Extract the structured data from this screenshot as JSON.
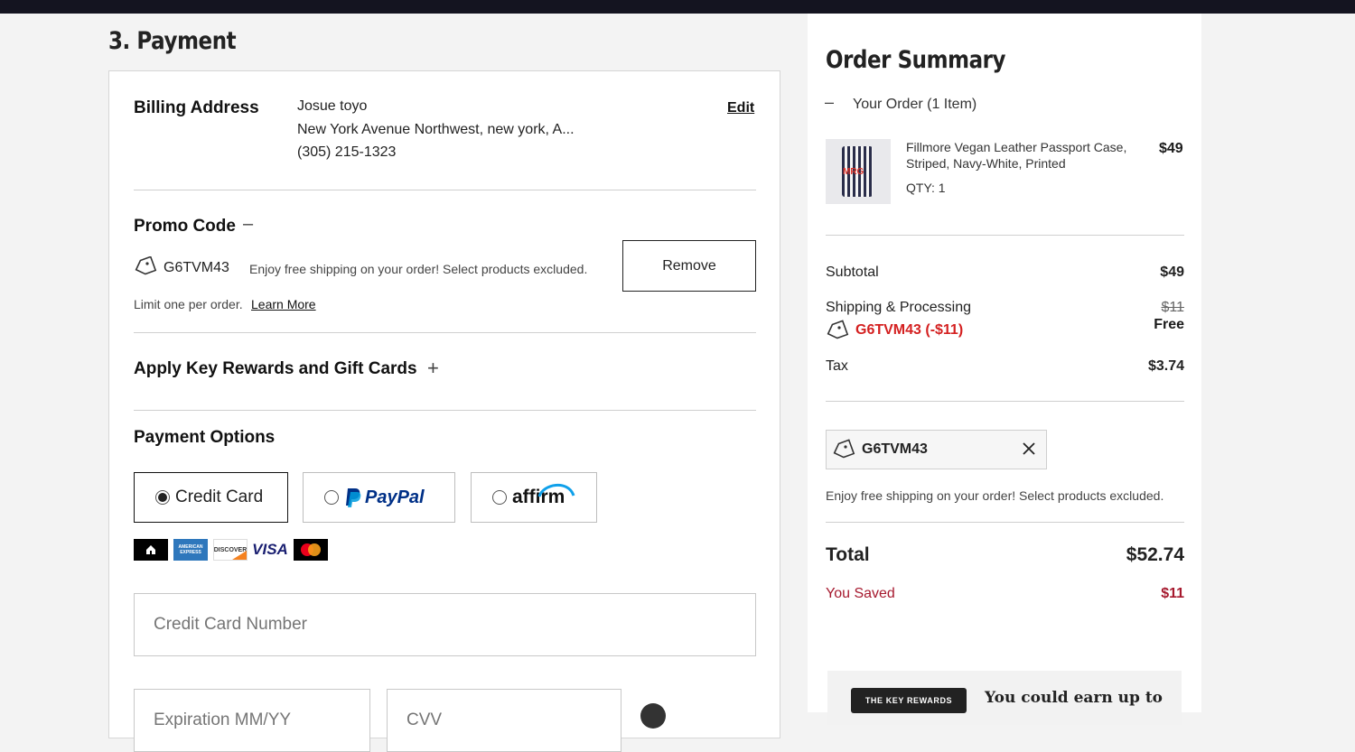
{
  "page": {
    "section_title": "3. Payment"
  },
  "billing": {
    "label": "Billing Address",
    "name": "Josue toyo",
    "address": "New York Avenue Northwest, new york, A...",
    "phone": "(305) 215-1323",
    "edit_label": "Edit"
  },
  "promo": {
    "label": "Promo Code",
    "toggle": "–",
    "code": "G6TVM43",
    "description": "Enjoy free shipping on your order! Select products excluded.",
    "remove_label": "Remove",
    "limit_text": "Limit one per order.",
    "learn_more": "Learn More"
  },
  "rewards_section": {
    "label": "Apply Key Rewards and Gift Cards",
    "toggle": "+"
  },
  "payment_options": {
    "label": "Payment Options",
    "options": [
      {
        "label": "Credit Card",
        "selected": true
      },
      {
        "label": "PayPal",
        "selected": false
      },
      {
        "label": "affirm",
        "selected": false
      }
    ],
    "card_logos": [
      "house-card-icon",
      "amex-icon",
      "discover-icon",
      "visa-icon",
      "mastercard-icon"
    ],
    "card_logo_text": {
      "amex": "AMERICAN EXPRESS",
      "discover": "DISCOVER",
      "visa": "VISA"
    },
    "card_number_placeholder": "Credit Card Number",
    "expiration_placeholder": "Expiration MM/YY",
    "cvv_placeholder": "CVV"
  },
  "summary": {
    "title": "Order Summary",
    "toggle": "–",
    "your_order": "Your Order (1 Item)",
    "item": {
      "name": "Fillmore Vegan Leather Passport Case, Striped, Navy-White, Printed",
      "price": "$49",
      "qty": "QTY: 1",
      "image_text": "MRG"
    },
    "subtotal_label": "Subtotal",
    "subtotal": "$49",
    "shipping_label": "Shipping & Processing",
    "shipping_original": "$11",
    "shipping_value": "Free",
    "shipping_promo": "G6TVM43 (-$11)",
    "tax_label": "Tax",
    "tax": "$3.74",
    "chip_code": "G6TVM43",
    "chip_description": "Enjoy free shipping on your order! Select products excluded.",
    "total_label": "Total",
    "total": "$52.74",
    "saved_label": "You Saved",
    "saved": "$11",
    "rewards_badge": "THE KEY REWARDS",
    "rewards_text": "You could earn up to"
  },
  "colors": {
    "promo_red": "#d42020",
    "saved_red": "#a6192e",
    "paypal_dark": "#003087",
    "paypal_light": "#009cde",
    "affirm_blue": "#0fa0ea"
  }
}
